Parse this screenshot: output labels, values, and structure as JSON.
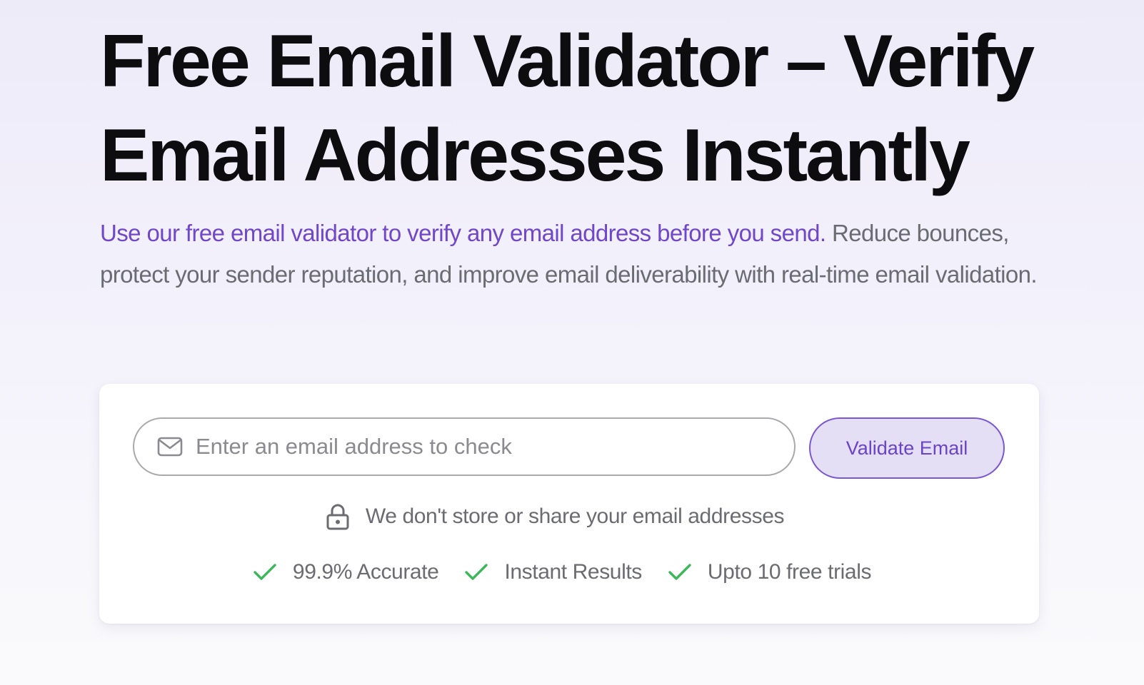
{
  "hero": {
    "title_line1": "Free Email Validator – Verify",
    "title_line2": "Email Addresses Instantly",
    "desc_highlight": "Use our free email validator to verify any email address before you send.",
    "desc_rest": " Reduce bounces, protect your sender reputation, and improve email deliverability with real-time email validation."
  },
  "form": {
    "email_placeholder": "Enter an email address to check",
    "email_value": "",
    "email_icon": "mail-icon",
    "submit_label": "Validate Email",
    "privacy_icon": "lock-icon",
    "privacy_note": "We don't store or share your email addresses"
  },
  "features": [
    {
      "icon": "check-icon",
      "label": "99.9% Accurate"
    },
    {
      "icon": "check-icon",
      "label": "Instant Results"
    },
    {
      "icon": "check-icon",
      "label": "Upto 10 free trials"
    }
  ],
  "colors": {
    "accent": "#7047c9",
    "button_bg": "#e5dff6",
    "check_green": "#3cb85a",
    "title": "#0d0d10",
    "body_text": "#6b6b72"
  }
}
